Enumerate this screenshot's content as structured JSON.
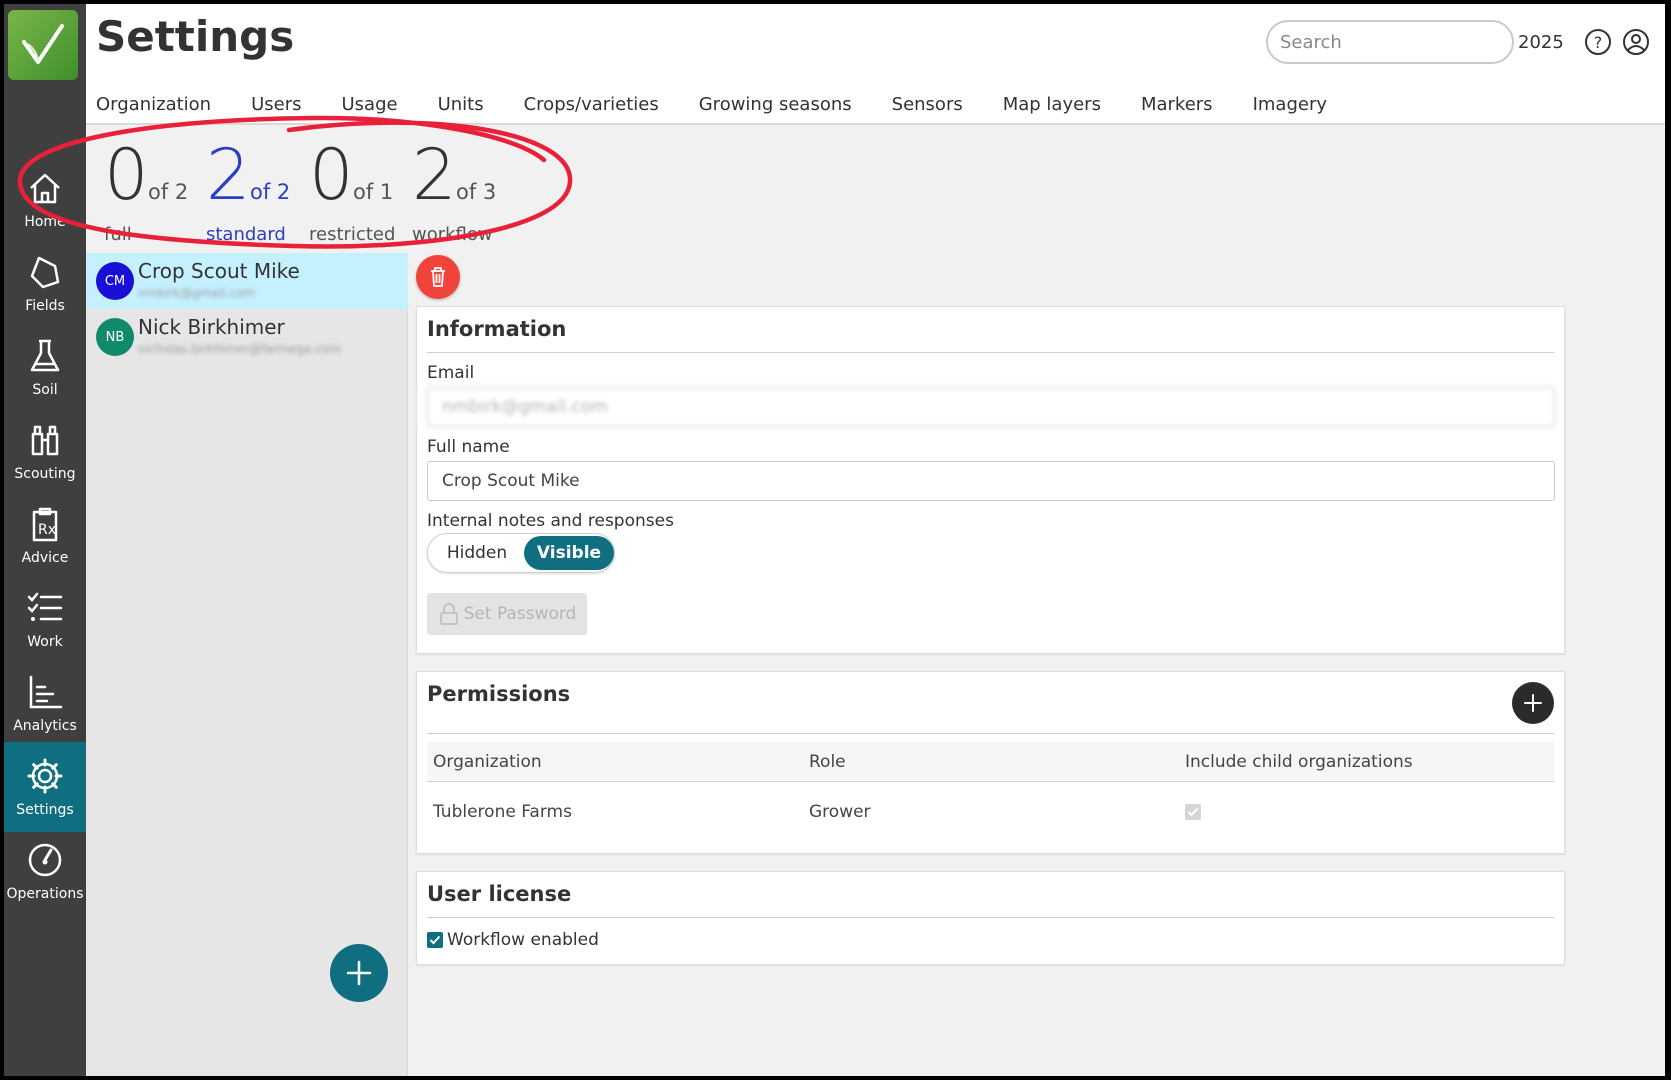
{
  "header": {
    "title": "Settings",
    "search_placeholder": "Search",
    "year": "2025"
  },
  "tabs": [
    "Organization",
    "Users",
    "Usage",
    "Units",
    "Crops/varieties",
    "Growing seasons",
    "Sensors",
    "Map layers",
    "Markers",
    "Imagery"
  ],
  "sidebar": {
    "items": [
      {
        "label": "Home",
        "icon": "home-icon"
      },
      {
        "label": "Fields",
        "icon": "fields-icon"
      },
      {
        "label": "Soil",
        "icon": "flask-icon"
      },
      {
        "label": "Scouting",
        "icon": "binoculars-icon"
      },
      {
        "label": "Advice",
        "icon": "prescription-clipboard-icon"
      },
      {
        "label": "Work",
        "icon": "checklist-icon"
      },
      {
        "label": "Analytics",
        "icon": "bar-chart-icon"
      },
      {
        "label": "Settings",
        "icon": "gear-icon",
        "active": true
      },
      {
        "label": "Operations",
        "icon": "gauge-icon"
      }
    ]
  },
  "licenses": [
    {
      "count": "0",
      "of": "of 2",
      "type": "full"
    },
    {
      "count": "2",
      "of": "of 2",
      "type": "standard",
      "highlight": true
    },
    {
      "count": "0",
      "of": "of 1",
      "type": "restricted"
    },
    {
      "count": "2",
      "of": "of 3",
      "type": "workflow"
    }
  ],
  "users": [
    {
      "initials": "CM",
      "name": "Crop Scout Mike",
      "email": "nmbirk@gmail.com",
      "avatar_color": "#1a0fd6",
      "selected": true
    },
    {
      "initials": "NB",
      "name": "Nick Birkhimer",
      "email": "nicholas.birkhimer@farmega.com",
      "avatar_color": "#0f8a6a"
    }
  ],
  "information": {
    "title": "Information",
    "email_label": "Email",
    "email_value": "nmbirk@gmail.com",
    "fullname_label": "Full name",
    "fullname_value": "Crop Scout Mike",
    "notes_label": "Internal notes and responses",
    "toggle_hidden": "Hidden",
    "toggle_visible": "Visible",
    "set_password": "Set Password"
  },
  "permissions": {
    "title": "Permissions",
    "columns": [
      "Organization",
      "Role",
      "Include child organizations"
    ],
    "rows": [
      {
        "organization": "Tublerone Farms",
        "role": "Grower",
        "include_children": true
      }
    ]
  },
  "user_license": {
    "title": "User license",
    "workflow_label": "Workflow enabled",
    "workflow_enabled": true
  },
  "colors": {
    "accent": "#0f6f80",
    "sidebar": "#3f3f3f",
    "danger": "#f0443b",
    "selected_row": "#c5f1ff",
    "annotation": "#e8203a"
  }
}
